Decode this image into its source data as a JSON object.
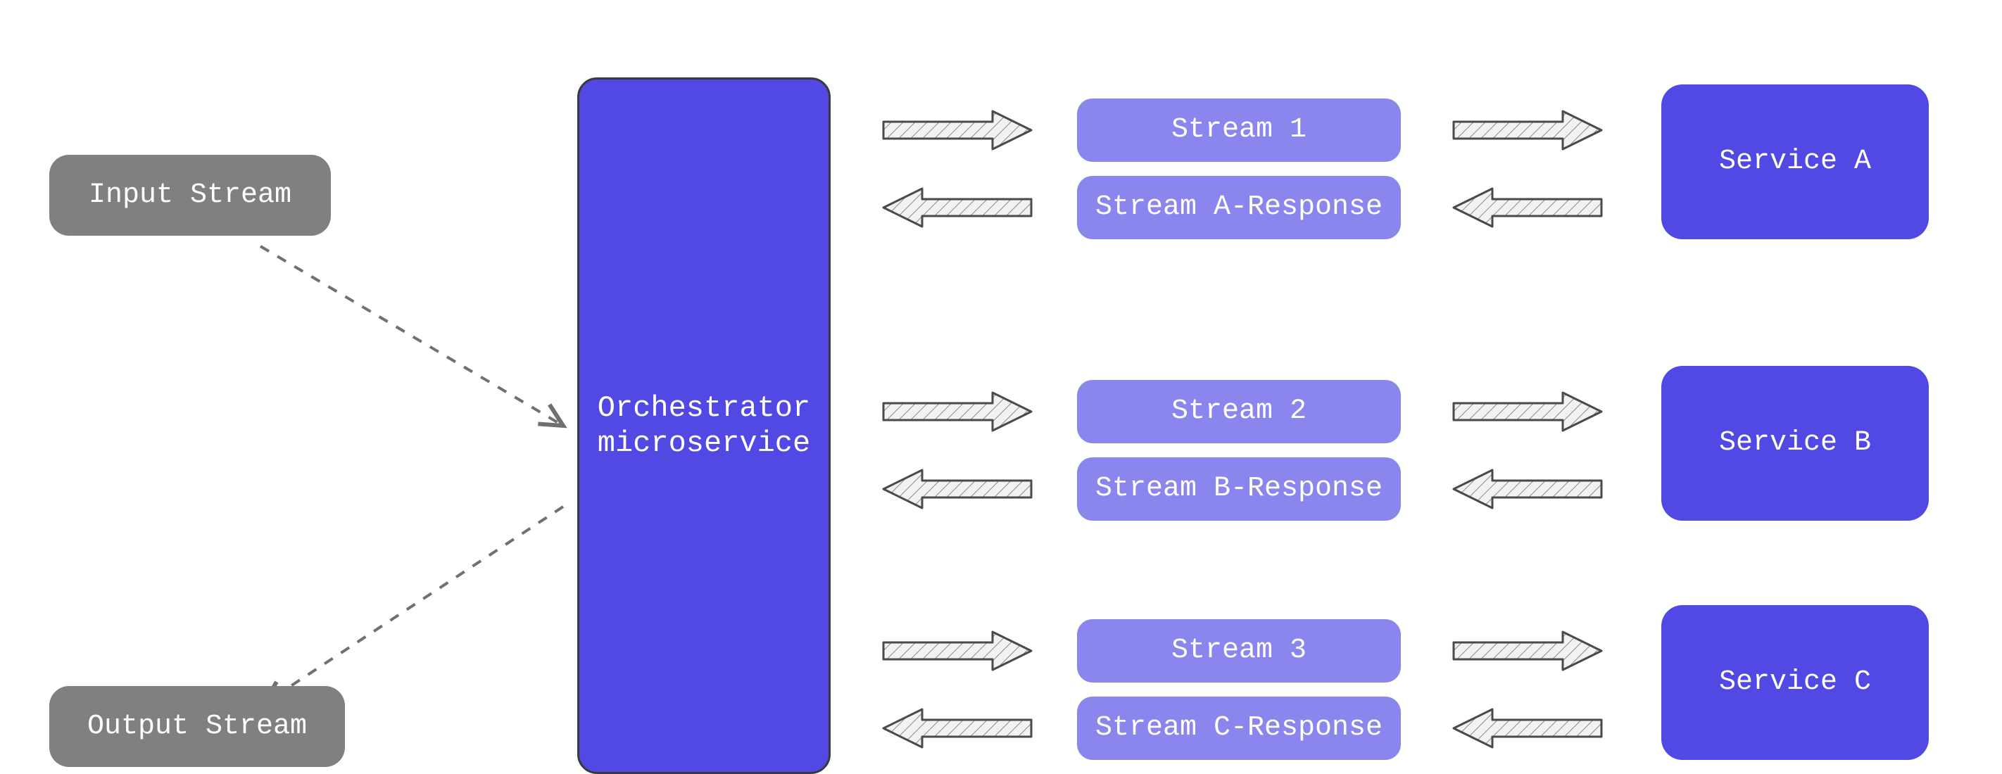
{
  "inputStream": {
    "label": "Input Stream"
  },
  "outputStream": {
    "label": "Output Stream"
  },
  "orchestrator": {
    "label": "Orchestrator\nmicroservice"
  },
  "streams": {
    "s1": {
      "label": "Stream 1"
    },
    "s1r": {
      "label": "Stream A-Response"
    },
    "s2": {
      "label": "Stream 2"
    },
    "s2r": {
      "label": "Stream B-Response"
    },
    "s3": {
      "label": "Stream 3"
    },
    "s3r": {
      "label": "Stream C-Response"
    }
  },
  "services": {
    "a": {
      "label": "Service A"
    },
    "b": {
      "label": "Service B"
    },
    "c": {
      "label": "Service C"
    }
  },
  "colors": {
    "gray": "#808080",
    "primary": "#5248e3",
    "primaryLight": "#8a86ee",
    "arrowStroke": "#5b5b5b",
    "arrowFill": "#e0e0e0",
    "dashStroke": "#707070"
  }
}
